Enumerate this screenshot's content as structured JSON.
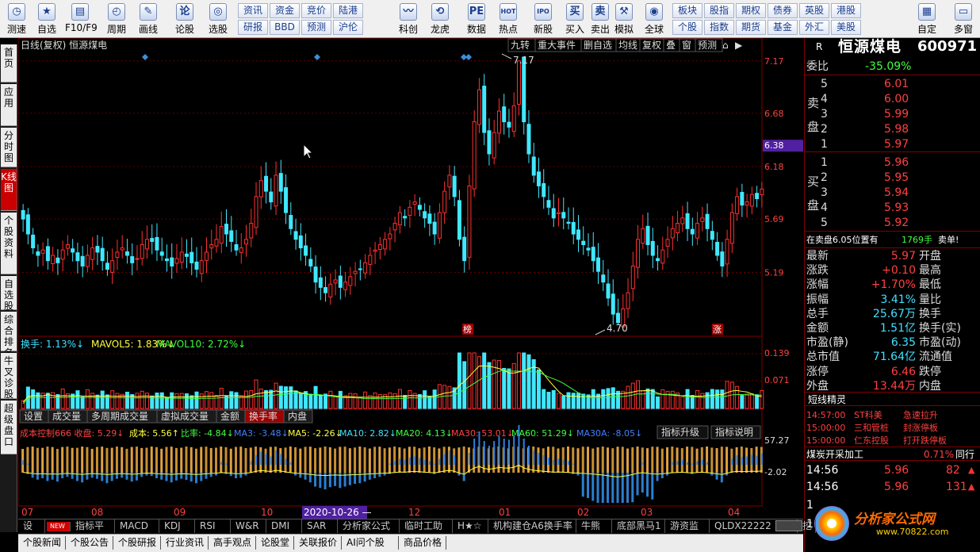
{
  "toolbar": {
    "big": [
      {
        "label": "测速",
        "icon": "◷"
      },
      {
        "label": "自选",
        "icon": "★"
      },
      {
        "label": "F10/F9",
        "icon": "▤"
      },
      {
        "label": "周期",
        "icon": "◴"
      },
      {
        "label": "画线",
        "icon": "✎"
      },
      {
        "label": "论股",
        "icon": "论"
      },
      {
        "label": "选股",
        "icon": "◎"
      },
      {
        "label": "科创",
        "icon": "〰"
      },
      {
        "label": "龙虎",
        "icon": "⟲"
      },
      {
        "label": "数据",
        "icon": "PE"
      },
      {
        "label": "热点",
        "icon": "HOT"
      },
      {
        "label": "新股",
        "icon": "IPO"
      },
      {
        "label": "买入",
        "icon": "买"
      },
      {
        "label": "卖出",
        "icon": "卖"
      },
      {
        "label": "模拟",
        "icon": "⚒"
      },
      {
        "label": "全球",
        "icon": "◉"
      },
      {
        "label": "自定",
        "icon": "▦"
      },
      {
        "label": "多窗",
        "icon": "▭"
      }
    ],
    "small_top": [
      "资讯",
      "资金",
      "竞价",
      "陆港",
      "板块",
      "股指",
      "期权",
      "债券",
      "英股",
      "港股"
    ],
    "small_bot": [
      "研报",
      "BBD",
      "预测",
      "沪伦",
      "个股",
      "指数",
      "期货",
      "基金",
      "外汇",
      "美股"
    ]
  },
  "leftnav": [
    "首页",
    "应用",
    "分时图",
    "K线图",
    "个股资料",
    "自选股",
    "综合排名",
    "牛叉诊股",
    "超级盘口"
  ],
  "chart": {
    "title": "日线(复权)  恒源煤电",
    "top_buttons": [
      "九转",
      "重大事件",
      "删自选",
      "均线",
      "复权",
      "叠",
      "窗",
      "预测"
    ],
    "price_axis": [
      "7.17",
      "6.68",
      "6.38",
      "6.18",
      "5.69",
      "5.19"
    ],
    "hi_label": "7.17",
    "lo_label": "4.70",
    "tag_bang": "榜",
    "tag_zhang": "涨",
    "vol_legend": {
      "a": "换手: 1.13%↓",
      "b": "MAVOL5: 1.83%↓",
      "c": "MAVOL10: 2.72%↓"
    },
    "vol_axis": [
      "0.139",
      "0.071"
    ],
    "mid_tabs": [
      "设置",
      "成交量",
      "多周期成交量",
      "虚拟成交量",
      "金额",
      "换手率",
      "内盘"
    ],
    "ind_legend": {
      "a": "成本控制666 收盘: 5.29↓",
      "b": "成本: 5.56↑",
      "c": "比率: -4.84↓",
      "d": "MA3: -3.48↓",
      "e": "MA5: -2.26↓",
      "f": "MA10: 2.82↓",
      "g": "MA20: 4.13↓",
      "h": "MA30: 53.01↓",
      "i": "MA60: 51.29↓",
      "j": "MA30A: -8.05↓"
    },
    "ind_buttons": [
      "指标升级",
      "指标说明"
    ],
    "ind_axis": [
      "57.27",
      "-2.02"
    ],
    "months": [
      "07",
      "08",
      "09",
      "10",
      "2020-10-26 —",
      "12",
      "01",
      "02",
      "03",
      "04"
    ]
  },
  "bottom_tabs": [
    "设置",
    "NEW",
    "指标平台",
    "MACD",
    "KDJ",
    "RSI",
    "W&R",
    "DMI",
    "SAR",
    "分析家公式网",
    "临时工助手",
    "H★☆",
    "机构建仓A6换手率",
    "牛熊图",
    "底部黑马1",
    "游资监控",
    "QLDX22222",
    "挖"
  ],
  "bottom_tabs2": [
    "个股新闻",
    "个股公告",
    "个股研报",
    "行业资讯",
    "高手观点",
    "论股堂",
    "关联报价",
    "AI问个股",
    "商品价格"
  ],
  "quote": {
    "r": "R",
    "name": "恒源煤电",
    "code": "600971",
    "weibi_label": "委比",
    "weibi": "-35.09%",
    "sell_label": "卖盘",
    "buy_label": "买盘",
    "sells": [
      {
        "n": "5",
        "p": "6.01"
      },
      {
        "n": "4",
        "p": "6.00"
      },
      {
        "n": "3",
        "p": "5.99"
      },
      {
        "n": "2",
        "p": "5.98"
      },
      {
        "n": "1",
        "p": "5.97"
      }
    ],
    "buys": [
      {
        "n": "1",
        "p": "5.96"
      },
      {
        "n": "2",
        "p": "5.95"
      },
      {
        "n": "3",
        "p": "5.94"
      },
      {
        "n": "4",
        "p": "5.93"
      },
      {
        "n": "5",
        "p": "5.92"
      }
    ],
    "info": "在卖盘6.05位置有",
    "info_qty": "1769手",
    "info_tag": "卖单!",
    "stats": [
      {
        "k": "最新",
        "v": "5.97",
        "k2": "开盘"
      },
      {
        "k": "涨跌",
        "v": "+0.10",
        "k2": "最高"
      },
      {
        "k": "涨幅",
        "v": "+1.70%",
        "k2": "最低"
      },
      {
        "k": "振幅",
        "v": "3.41%",
        "k2": "量比"
      },
      {
        "k": "总手",
        "v": "25.67万",
        "k2": "换手"
      },
      {
        "k": "金额",
        "v": "1.51亿",
        "k2": "换手(实)"
      },
      {
        "k": "市盈(静)",
        "v": "6.35",
        "k2": "市盈(动)"
      },
      {
        "k": "总市值",
        "v": "71.64亿",
        "k2": "流通值"
      },
      {
        "k": "涨停",
        "v": "6.46",
        "k2": "跌停"
      },
      {
        "k": "外盘",
        "v": "13.44万",
        "k2": "内盘"
      }
    ],
    "jl_title": "短线精灵",
    "jl": [
      {
        "t": "14:57:00",
        "s": "ST科美",
        "e": "急速拉升"
      },
      {
        "t": "15:00:00",
        "s": "三和管桩",
        "e": "封涨停板"
      },
      {
        "t": "15:00:00",
        "s": "仁东控股",
        "e": "打开跌停板"
      }
    ],
    "sector": "煤炭开采加工",
    "sector_pct": "0.71%",
    "sector_btn": "同行",
    "ticks": [
      {
        "t": "14:56",
        "p": "5.96",
        "v": "82"
      },
      {
        "t": "14:56",
        "p": "5.96",
        "v": "131"
      }
    ],
    "ones": [
      "1",
      "1"
    ],
    "logo": "分析家公式网",
    "logo_url": "www.70822.com"
  },
  "colors": {
    "up": "#ff3030",
    "down": "#40e8ff",
    "grid": "#800000"
  },
  "chart_data": {
    "type": "candlestick",
    "title": "日线(复权) 恒源煤电",
    "ylim": [
      4.6,
      7.25
    ],
    "closes": [
      5.69,
      5.55,
      5.42,
      5.35,
      5.4,
      5.3,
      5.35,
      5.28,
      5.4,
      5.45,
      5.38,
      5.3,
      5.25,
      5.35,
      5.42,
      5.38,
      5.3,
      5.22,
      5.3,
      5.38,
      5.42,
      5.35,
      5.28,
      5.32,
      5.45,
      5.5,
      5.48,
      5.4,
      5.35,
      5.3,
      5.25,
      5.32,
      5.38,
      5.34,
      5.28,
      5.22,
      5.3,
      5.38,
      5.45,
      5.5,
      5.62,
      5.55,
      5.48,
      5.4,
      5.42,
      5.5,
      5.65,
      5.9,
      6.05,
      5.95,
      5.85,
      6.1,
      5.95,
      5.75,
      5.6,
      5.5,
      5.42,
      5.35,
      5.25,
      5.1,
      5.05,
      5.0,
      5.08,
      5.12,
      5.05,
      5.1,
      5.15,
      5.2,
      5.22,
      5.28,
      5.35,
      5.4,
      5.45,
      5.5,
      5.55,
      5.65,
      5.75,
      5.7,
      5.8,
      5.85,
      5.78,
      5.7,
      5.65,
      5.55,
      5.75,
      5.95,
      6.1,
      5.9,
      5.5,
      5.3,
      6.0,
      6.6,
      6.9,
      6.5,
      6.3,
      6.5,
      6.7,
      6.6,
      6.55,
      6.75,
      7.17,
      6.6,
      6.3,
      6.1,
      6.0,
      5.9,
      5.8,
      5.7,
      5.75,
      5.7,
      5.65,
      5.55,
      5.5,
      5.45,
      5.4,
      5.3,
      5.2,
      5.1,
      4.95,
      4.8,
      4.72,
      4.85,
      5.0,
      5.25,
      5.5,
      5.6,
      5.45,
      5.35,
      5.3,
      5.4,
      5.5,
      5.6,
      5.65,
      5.7,
      5.6,
      5.55,
      5.65,
      5.7,
      5.6,
      5.5,
      5.35,
      5.25,
      5.5,
      5.75,
      5.9,
      5.82,
      5.85,
      5.92,
      5.88,
      5.97
    ]
  }
}
